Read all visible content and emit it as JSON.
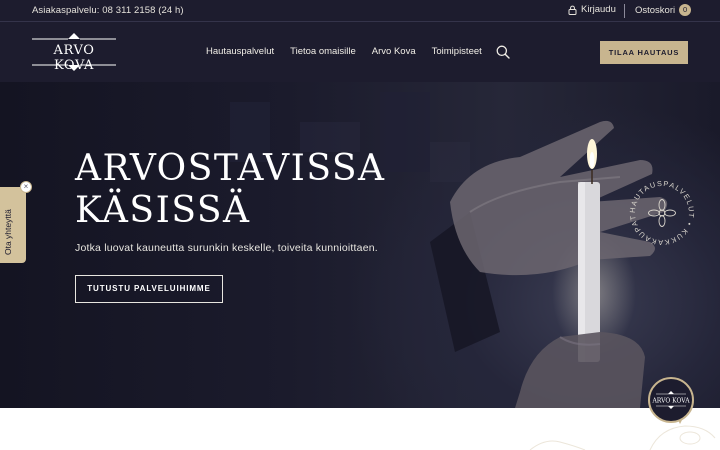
{
  "topbar": {
    "phone": "Asiakaspalvelu: 08 311 2158 (24 h)",
    "login_label": "Kirjaudu",
    "cart_label": "Ostoskori",
    "cart_count": "0"
  },
  "header": {
    "logo_text": "ARVO KOVA",
    "nav": [
      "Hautauspalvelut",
      "Tietoa omaisille",
      "Arvo Kova",
      "Toimipisteet"
    ],
    "order_button": "TILAA HAUTAUS"
  },
  "hero": {
    "title_line1": "ARVOSTAVISSA",
    "title_line2": "KÄSISSÄ",
    "subtitle": "Jotka luovat kauneutta surunkin keskelle, toiveita kunnioittaen.",
    "cta": "TUTUSTU PALVELUIHIMME",
    "badge_text": "HAUTAUSPALVELUT • KUKKAKAUPAT •"
  },
  "side_tab": {
    "label": "Ota yhteyttä",
    "close_symbol": "×"
  },
  "chat": {
    "label": "ARVO KOVA"
  },
  "icons": {
    "lock": "lock-icon",
    "search": "search-icon",
    "close": "close-icon",
    "chat": "chat-icon"
  },
  "colors": {
    "header_bg": "#1d1c2e",
    "accent_gold": "#c8b58f",
    "text_light": "#e6e3dc"
  }
}
